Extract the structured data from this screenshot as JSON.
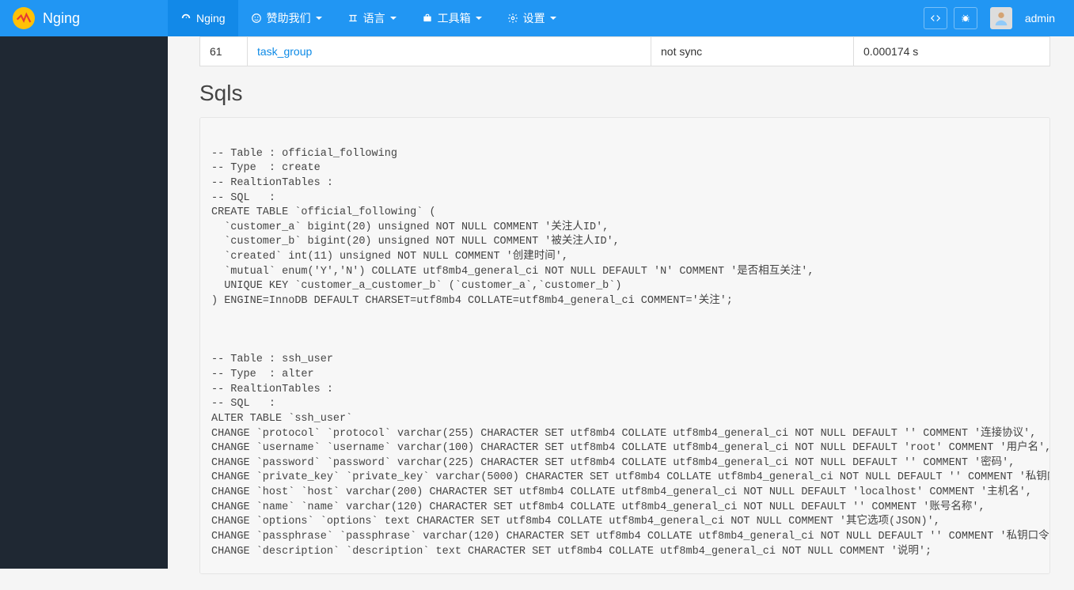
{
  "brand": "Nging",
  "nav": {
    "home": "Nging",
    "sponsor": "赞助我们",
    "language": "语言",
    "toolbox": "工具箱",
    "settings": "设置"
  },
  "user": {
    "name": "admin"
  },
  "tableRow": {
    "id": "61",
    "name": "task_group",
    "status": "not sync",
    "time": "0.000174 s"
  },
  "sqlsTitle": "Sqls",
  "sqlText": "\n-- Table : official_following\n-- Type  : create\n-- RealtionTables :\n-- SQL   :\nCREATE TABLE `official_following` (\n  `customer_a` bigint(20) unsigned NOT NULL COMMENT '关注人ID',\n  `customer_b` bigint(20) unsigned NOT NULL COMMENT '被关注人ID',\n  `created` int(11) unsigned NOT NULL COMMENT '创建时间',\n  `mutual` enum('Y','N') COLLATE utf8mb4_general_ci NOT NULL DEFAULT 'N' COMMENT '是否相互关注',\n  UNIQUE KEY `customer_a_customer_b` (`customer_a`,`customer_b`)\n) ENGINE=InnoDB DEFAULT CHARSET=utf8mb4 COLLATE=utf8mb4_general_ci COMMENT='关注';\n\n\n\n-- Table : ssh_user\n-- Type  : alter\n-- RealtionTables :\n-- SQL   :\nALTER TABLE `ssh_user`\nCHANGE `protocol` `protocol` varchar(255) CHARACTER SET utf8mb4 COLLATE utf8mb4_general_ci NOT NULL DEFAULT '' COMMENT '连接协议',\nCHANGE `username` `username` varchar(100) CHARACTER SET utf8mb4 COLLATE utf8mb4_general_ci NOT NULL DEFAULT 'root' COMMENT '用户名',\nCHANGE `password` `password` varchar(225) CHARACTER SET utf8mb4 COLLATE utf8mb4_general_ci NOT NULL DEFAULT '' COMMENT '密码',\nCHANGE `private_key` `private_key` varchar(5000) CHARACTER SET utf8mb4 COLLATE utf8mb4_general_ci NOT NULL DEFAULT '' COMMENT '私钥内容',\nCHANGE `host` `host` varchar(200) CHARACTER SET utf8mb4 COLLATE utf8mb4_general_ci NOT NULL DEFAULT 'localhost' COMMENT '主机名',\nCHANGE `name` `name` varchar(120) CHARACTER SET utf8mb4 COLLATE utf8mb4_general_ci NOT NULL DEFAULT '' COMMENT '账号名称',\nCHANGE `options` `options` text CHARACTER SET utf8mb4 COLLATE utf8mb4_general_ci NOT NULL COMMENT '其它选项(JSON)',\nCHANGE `passphrase` `passphrase` varchar(120) CHARACTER SET utf8mb4 COLLATE utf8mb4_general_ci NOT NULL DEFAULT '' COMMENT '私钥口令',\nCHANGE `description` `description` text CHARACTER SET utf8mb4 COLLATE utf8mb4_general_ci NOT NULL COMMENT '说明';"
}
